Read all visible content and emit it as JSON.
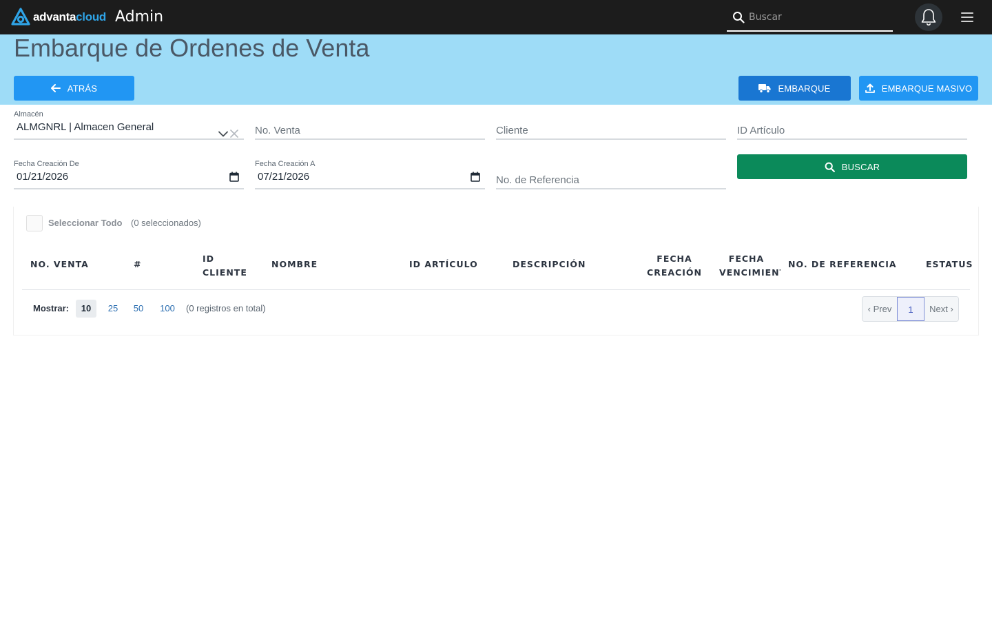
{
  "navbar": {
    "logo_left": "advanta",
    "logo_right": "cloud",
    "app_title": "Admin",
    "search_placeholder": "Buscar"
  },
  "header": {
    "title": "Embarque de Ordenes de Venta",
    "back_label": "ATRÁS",
    "embarque_label": "EMBARQUE",
    "masivo_label": "EMBARQUE MASIVO"
  },
  "filters": {
    "almacen_label": "Almacén",
    "almacen_value": "ALMGNRL | Almacen General",
    "no_venta_placeholder": "No. Venta",
    "cliente_placeholder": "Cliente",
    "id_articulo_placeholder": "ID Artículo",
    "fecha_de_label": "Fecha Creación De",
    "fecha_de_value": "01/21/2026",
    "fecha_a_label": "Fecha Creación A",
    "fecha_a_value": "07/21/2026",
    "referencia_placeholder": "No. de Referencia",
    "buscar_label": "BUSCAR"
  },
  "table": {
    "select_all_label": "Seleccionar Todo",
    "selected_count": "(0 seleccionados)",
    "columns": {
      "no_venta": "NO. VENTA",
      "num": "#",
      "id_cliente_1": "ID",
      "id_cliente_2": "CLIENTE",
      "nombre": "NOMBRE",
      "id_articulo": "ID ARTÍCULO",
      "descripcion": "DESCRIPCIÓN",
      "fecha_creacion_1": "FECHA",
      "fecha_creacion_2": "CREACIÓN",
      "fecha_venc_1": "FECHA",
      "fecha_venc_2": "VENCIMIENTO",
      "no_referencia": "NO. DE REFERENCIA",
      "estatus": "ESTATUS"
    },
    "rows": []
  },
  "pagination": {
    "show_label": "Mostrar:",
    "page_sizes": [
      "10",
      "25",
      "50",
      "100"
    ],
    "active_page_size": "10",
    "total_text": "(0 registros en total)",
    "prev_label": "‹ Prev",
    "current_page": "1",
    "next_label": "Next ›"
  },
  "colors": {
    "navbar": "#1c1c1c",
    "header_band": "#9edcf7",
    "primary": "#2196f3",
    "primary_dark": "#1976d2",
    "success": "#0b8a5a"
  }
}
